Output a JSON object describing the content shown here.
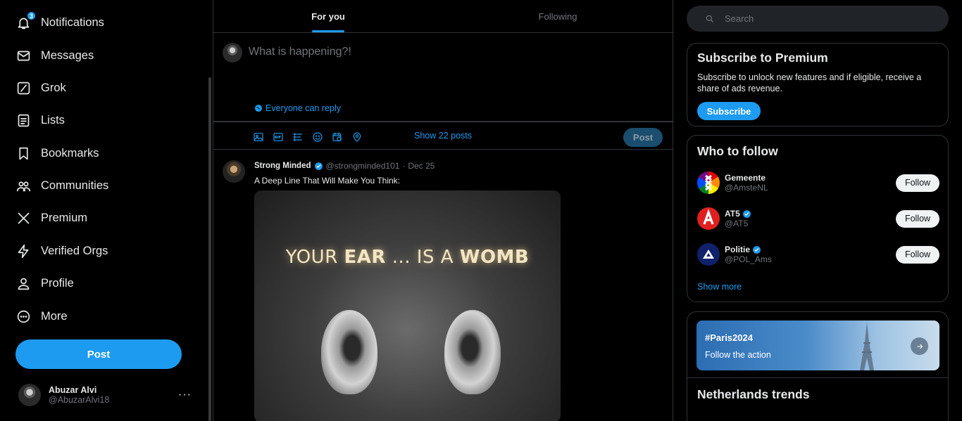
{
  "nav": {
    "items": [
      {
        "label": "Notifications",
        "icon": "bell-icon",
        "badge": "3"
      },
      {
        "label": "Messages",
        "icon": "envelope-icon"
      },
      {
        "label": "Grok",
        "icon": "grok-icon"
      },
      {
        "label": "Lists",
        "icon": "list-icon"
      },
      {
        "label": "Bookmarks",
        "icon": "bookmark-icon"
      },
      {
        "label": "Communities",
        "icon": "communities-icon"
      },
      {
        "label": "Premium",
        "icon": "x-logo-icon"
      },
      {
        "label": "Verified Orgs",
        "icon": "lightning-icon"
      },
      {
        "label": "Profile",
        "icon": "person-icon"
      },
      {
        "label": "More",
        "icon": "more-circle-icon"
      }
    ],
    "post_label": "Post",
    "account": {
      "name": "Abuzar Alvi",
      "handle": "@AbuzarAlvi18",
      "menu": "···"
    }
  },
  "feed": {
    "tabs": [
      {
        "label": "For you"
      },
      {
        "label": "Following"
      }
    ],
    "compose": {
      "placeholder": "What is happening?!",
      "reply_setting": "Everyone can reply",
      "post_label": "Post"
    },
    "show_posts": "Show 22 posts",
    "tweet": {
      "name": "Strong Minded",
      "handle": "@strongminded101",
      "separator": "·",
      "date": "Dec 25",
      "text": "A Deep Line That Will Make You Think:",
      "media_text": {
        "part1": "YOUR ",
        "part2": "EAR",
        "part3": " ... IS A ",
        "part4": "WOMB"
      }
    }
  },
  "right": {
    "search_placeholder": "Search",
    "premium": {
      "title": "Subscribe to Premium",
      "desc": "Subscribe to unlock new features and if eligible, receive a share of ads revenue.",
      "button": "Subscribe"
    },
    "who_to_follow": {
      "title": "Who to follow",
      "accounts": [
        {
          "name": "Gemeente",
          "handle": "@AmsteNL",
          "verified": false,
          "button": "Follow"
        },
        {
          "name": "AT5",
          "handle": "@AT5",
          "verified": true,
          "button": "Follow"
        },
        {
          "name": "Politie",
          "handle": "@POL_Ams",
          "verified": true,
          "button": "Follow"
        }
      ],
      "show_more": "Show more"
    },
    "banner": {
      "title": "#Paris2024",
      "subtitle": "Follow the action"
    },
    "trends_title": "Netherlands trends"
  },
  "colors": {
    "accent": "#1d9bf0",
    "background": "#000000",
    "border": "#2f3336",
    "muted": "#71767b"
  }
}
